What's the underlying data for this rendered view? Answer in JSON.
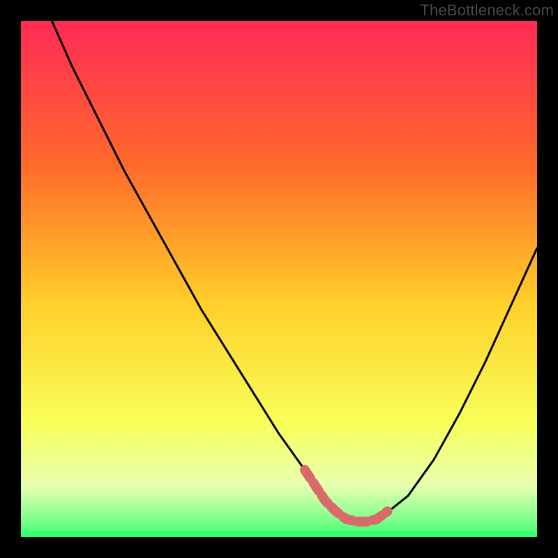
{
  "watermark": "TheBottleneck.com",
  "colors": {
    "background": "#000000",
    "gradient_top": "#ff2a55",
    "gradient_mid1": "#ff8a2a",
    "gradient_mid2": "#ffe12a",
    "gradient_low": "#f6ff7a",
    "gradient_bottom": "#2aff6a",
    "curve": "#000000",
    "marker": "#d86a6a"
  },
  "chart_data": {
    "type": "line",
    "title": "",
    "xlabel": "",
    "ylabel": "",
    "xlim": [
      0,
      100
    ],
    "ylim": [
      0,
      100
    ],
    "series": [
      {
        "name": "bottleneck-curve",
        "x": [
          6,
          10,
          15,
          20,
          25,
          30,
          35,
          40,
          45,
          50,
          55,
          58,
          60,
          62,
          64,
          66,
          68,
          70,
          75,
          80,
          85,
          90,
          95,
          100
        ],
        "y": [
          100,
          91,
          81,
          71,
          62,
          53,
          44,
          36,
          28,
          20,
          13,
          9,
          6,
          4,
          3,
          3,
          3,
          4,
          8,
          15,
          24,
          34,
          45,
          56
        ]
      }
    ],
    "markers": {
      "name": "highlighted-segment",
      "x": [
        55,
        57,
        59,
        61,
        63,
        65,
        67,
        69,
        71
      ],
      "y": [
        13,
        10,
        7,
        5,
        3.5,
        3,
        3,
        3.5,
        5
      ]
    }
  }
}
